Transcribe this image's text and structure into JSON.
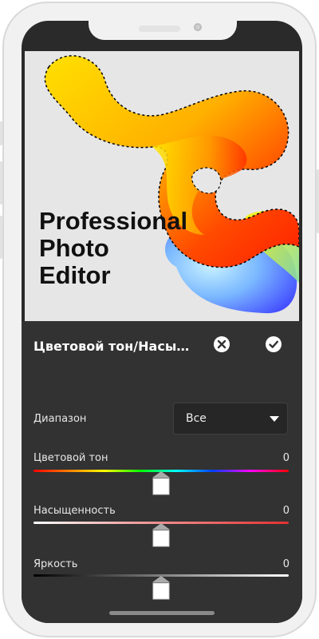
{
  "promo": {
    "line1": "Professional",
    "line2": "Photo",
    "line3": "Editor"
  },
  "panel": {
    "title": "Цветовой тон/Насыщенность",
    "cancel_icon": "close-circle-icon",
    "apply_icon": "check-circle-icon",
    "range": {
      "label": "Диапазон",
      "selected": "Все"
    },
    "sliders": [
      {
        "label": "Цветовой тон",
        "value": "0",
        "position": 0.5
      },
      {
        "label": "Насыщенность",
        "value": "0",
        "position": 0.5
      },
      {
        "label": "Яркость",
        "value": "0",
        "position": 0.5
      }
    ]
  },
  "colors": {
    "panel_bg": "#323232",
    "canvas_bg": "#e6e6e6",
    "blob_yellow": "#ffd400",
    "blob_red": "#ff2a00",
    "blob_blue": "#4a6cff",
    "saturation_red": "#e53030"
  }
}
